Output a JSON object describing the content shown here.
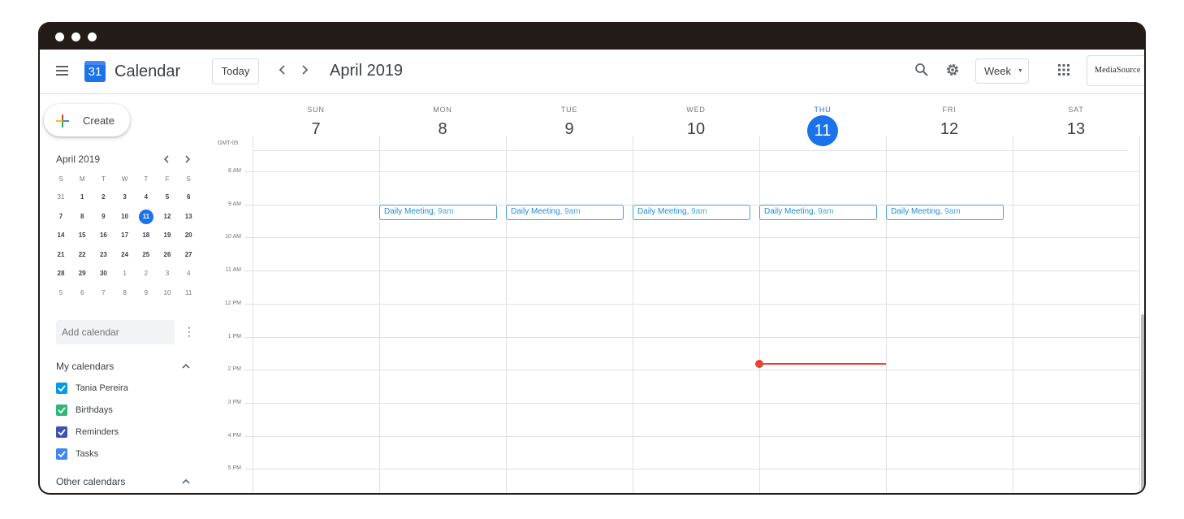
{
  "app": {
    "title": "Calendar",
    "logo_day": "31",
    "today_label": "Today",
    "prev_icon": "chevron-left-icon",
    "next_icon": "chevron-right-icon",
    "current_period": "April 2019",
    "view_selector": "Week",
    "account_brand": "MediaSource"
  },
  "sidebar": {
    "create_label": "Create",
    "mini_calendar": {
      "title": "April 2019",
      "weekday_headers": [
        "S",
        "M",
        "T",
        "W",
        "T",
        "F",
        "S"
      ],
      "weeks": [
        [
          "31",
          "1",
          "2",
          "3",
          "4",
          "5",
          "6"
        ],
        [
          "7",
          "8",
          "9",
          "10",
          "11",
          "12",
          "13"
        ],
        [
          "14",
          "15",
          "16",
          "17",
          "18",
          "19",
          "20"
        ],
        [
          "21",
          "22",
          "23",
          "24",
          "25",
          "26",
          "27"
        ],
        [
          "28",
          "29",
          "30",
          "1",
          "2",
          "3",
          "4"
        ],
        [
          "5",
          "6",
          "7",
          "8",
          "9",
          "10",
          "11"
        ]
      ],
      "selected_day": "11"
    },
    "add_calendar_placeholder": "Add calendar",
    "my_calendars_label": "My calendars",
    "my_calendars": [
      {
        "label": "Tania Pereira",
        "color": "#039be5"
      },
      {
        "label": "Birthdays",
        "color": "#33b679"
      },
      {
        "label": "Reminders",
        "color": "#3f51b5"
      },
      {
        "label": "Tasks",
        "color": "#4285f4"
      }
    ],
    "other_calendars_label": "Other calendars"
  },
  "week": {
    "timezone": "GMT-05",
    "days": [
      {
        "dow": "SUN",
        "num": "7"
      },
      {
        "dow": "MON",
        "num": "8"
      },
      {
        "dow": "TUE",
        "num": "9"
      },
      {
        "dow": "WED",
        "num": "10"
      },
      {
        "dow": "THU",
        "num": "11",
        "today": true
      },
      {
        "dow": "FRI",
        "num": "12"
      },
      {
        "dow": "SAT",
        "num": "13"
      }
    ],
    "hours": [
      "8 AM",
      "9 AM",
      "10 AM",
      "11 AM",
      "12 PM",
      "1 PM",
      "2 PM",
      "3 PM",
      "4 PM",
      "5 PM"
    ],
    "events": [
      {
        "title": "Daily Meeting",
        "time": "9am",
        "day": "MON"
      },
      {
        "title": "Daily Meeting",
        "time": "9am",
        "day": "TUE"
      },
      {
        "title": "Daily Meeting",
        "time": "9am",
        "day": "WED"
      },
      {
        "title": "Daily Meeting",
        "time": "9am",
        "day": "THU"
      },
      {
        "title": "Daily Meeting",
        "time": "9am",
        "day": "FRI"
      }
    ],
    "now_indicator_color": "#ea4335",
    "accent_color": "#1a73e8"
  }
}
